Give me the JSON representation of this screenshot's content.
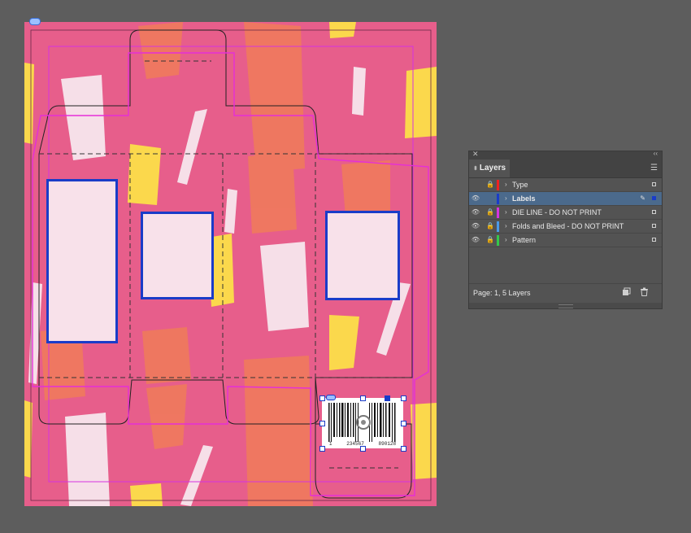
{
  "barcode": {
    "digits": [
      "1",
      "234567",
      "890128"
    ]
  },
  "layers_panel": {
    "tab_label": "Layers",
    "status": "Page: 1, 5 Layers",
    "layers": [
      {
        "name": "Type",
        "color": "#ee2222",
        "visible": false,
        "locked": true
      },
      {
        "name": "Labels",
        "color": "#1a3cc8",
        "visible": true,
        "locked": false,
        "selected": true
      },
      {
        "name": "DIE LINE - DO NOT PRINT",
        "color": "#d633e0",
        "visible": true,
        "locked": true
      },
      {
        "name": "Folds and Bleed - DO NOT PRINT",
        "color": "#4a9ae8",
        "visible": true,
        "locked": true
      },
      {
        "name": "Pattern",
        "color": "#34c84a",
        "visible": true,
        "locked": true
      }
    ]
  },
  "colors": {
    "artboard": "#e75e8b",
    "die_line": "#d633e0",
    "selection": "#1a3cc8"
  }
}
